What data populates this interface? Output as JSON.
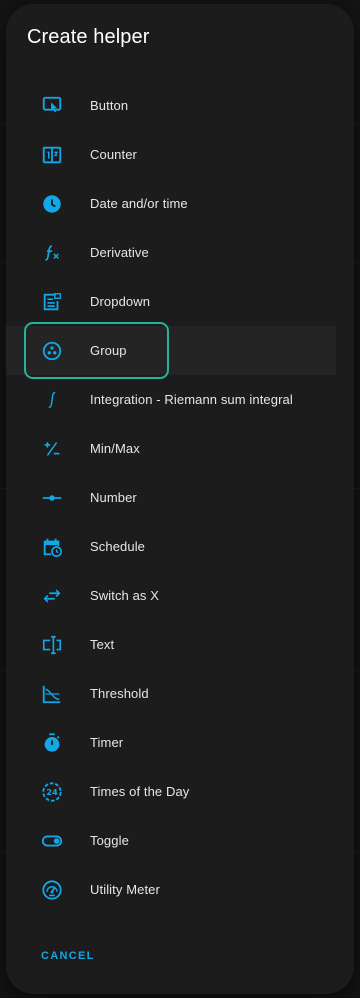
{
  "dialog": {
    "title": "Create helper",
    "cancel_label": "CANCEL",
    "items": [
      {
        "label": "Button",
        "icon": "button-press-icon"
      },
      {
        "label": "Counter",
        "icon": "counter-icon"
      },
      {
        "label": "Date and/or time",
        "icon": "clock-icon"
      },
      {
        "label": "Derivative",
        "icon": "function-icon"
      },
      {
        "label": "Dropdown",
        "icon": "dropdown-form-icon"
      },
      {
        "label": "Group",
        "icon": "group-icon"
      },
      {
        "label": "Integration - Riemann sum integral",
        "icon": "integral-icon"
      },
      {
        "label": "Min/Max",
        "icon": "plus-minus-icon"
      },
      {
        "label": "Number",
        "icon": "slider-icon"
      },
      {
        "label": "Schedule",
        "icon": "calendar-clock-icon"
      },
      {
        "label": "Switch as X",
        "icon": "swap-arrows-icon"
      },
      {
        "label": "Text",
        "icon": "text-cursor-icon"
      },
      {
        "label": "Threshold",
        "icon": "threshold-chart-icon"
      },
      {
        "label": "Timer",
        "icon": "timer-icon"
      },
      {
        "label": "Times of the Day",
        "icon": "24-hour-icon"
      },
      {
        "label": "Toggle",
        "icon": "toggle-icon"
      },
      {
        "label": "Utility Meter",
        "icon": "gauge-icon"
      }
    ],
    "selected_item": "Group"
  },
  "colors": {
    "accent": "#11a7e8",
    "focus_ring": "#23b59a",
    "surface": "#1c1c1c",
    "text": "#e6e6e6"
  }
}
